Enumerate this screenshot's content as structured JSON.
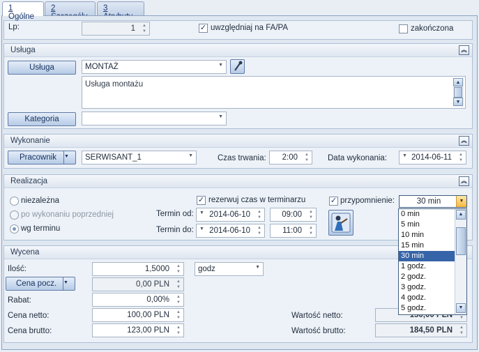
{
  "tabs": [
    {
      "key": "1",
      "label": " Ogólne"
    },
    {
      "key": "2",
      "label": " Szczegóły"
    },
    {
      "key": "3",
      "label": " Atrybuty"
    }
  ],
  "top": {
    "lp_label": "Lp:",
    "lp_value": "1",
    "uwzgledniaj_label": "uwzględniaj na FA/PA",
    "zakonczona_label": "zakończona"
  },
  "usluga": {
    "header": "Usługa",
    "usluga_button": "Usługa",
    "usluga_value": "MONTAŻ",
    "description": "Usługa montażu",
    "kategoria_button": "Kategoria",
    "kategoria_value": ""
  },
  "wykonanie": {
    "header": "Wykonanie",
    "pracownik_button": "Pracownik",
    "pracownik_value": "SERWISANT_1",
    "czas_label": "Czas trwania:",
    "czas_value": "2:00",
    "data_label": "Data wykonania:",
    "data_value": "2014-06-11"
  },
  "realizacja": {
    "header": "Realizacja",
    "niezalezna": "niezależna",
    "po_wykonaniu": "po wykonaniu poprzedniej",
    "wg_terminu": "wg terminu",
    "rezerwuj_label": "rezerwuj czas w terminarzu",
    "termin_od_label": "Termin od:",
    "termin_od_date": "2014-06-10",
    "termin_od_time": "09:00",
    "termin_do_label": "Termin do:",
    "termin_do_date": "2014-06-10",
    "termin_do_time": "11:00",
    "przypomnienie_label": "przypomnienie:",
    "przypomnienie_value": "30 min",
    "dropdown_options": [
      "0 min",
      "5 min",
      "10 min",
      "15 min",
      "30 min",
      "1 godz.",
      "2 godz.",
      "3 godz.",
      "4 godz.",
      "5 godz."
    ],
    "selected_option": "30 min"
  },
  "wycena": {
    "header": "Wycena",
    "ilosc_label": "Ilość:",
    "ilosc_value": "1,5000",
    "jm_value": "godz",
    "cena_pocz_button": "Cena pocz.",
    "cena_pocz_value": "0,00 PLN",
    "rabat_label": "Rabat:",
    "rabat_value": "0,00%",
    "cena_netto_label": "Cena netto:",
    "cena_netto_value": "100,00 PLN",
    "cena_brutto_label": "Cena brutto:",
    "cena_brutto_value": "123,00 PLN",
    "wartosc_netto_label": "Wartość netto:",
    "wartosc_netto_value": "150,00 PLN",
    "wartosc_brutto_label": "Wartość brutto:",
    "wartosc_brutto_value": "184,50 PLN"
  },
  "colors": {
    "accent": "#3664a8",
    "panel": "#edf2f8",
    "border": "#8da2c0"
  }
}
